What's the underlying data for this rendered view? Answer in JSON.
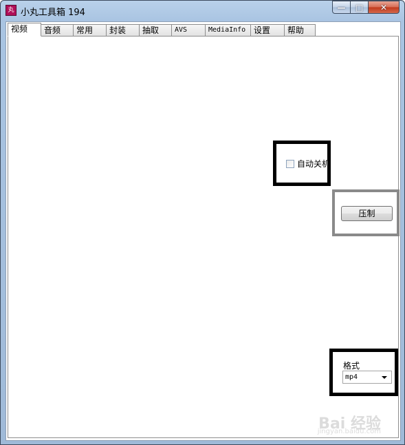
{
  "window": {
    "title": "小丸工具箱 194",
    "icon_text": "丸",
    "controls": {
      "minimize": "—",
      "maximize": "□",
      "close": "✕"
    }
  },
  "tabs": [
    {
      "label": "视频",
      "active": true
    },
    {
      "label": "音频",
      "active": false
    },
    {
      "label": "常用",
      "active": false
    },
    {
      "label": "封装",
      "active": false
    },
    {
      "label": "抽取",
      "active": false
    },
    {
      "label": "AVS",
      "active": false
    },
    {
      "label": "MediaInfo",
      "active": false
    },
    {
      "label": "设置",
      "active": false
    },
    {
      "label": "帮助",
      "active": false
    }
  ],
  "video_panel": {
    "auto_shutdown": {
      "label": "自动关机",
      "checked": false
    },
    "compress_button": "压制",
    "format": {
      "label": "格式",
      "selected": "mp4"
    }
  },
  "watermark": {
    "brand": "Bai 经验",
    "url": "jingyan.baidu.com"
  },
  "colors": {
    "highlight_box": "#000000",
    "button_box": "#8a8a8a"
  }
}
